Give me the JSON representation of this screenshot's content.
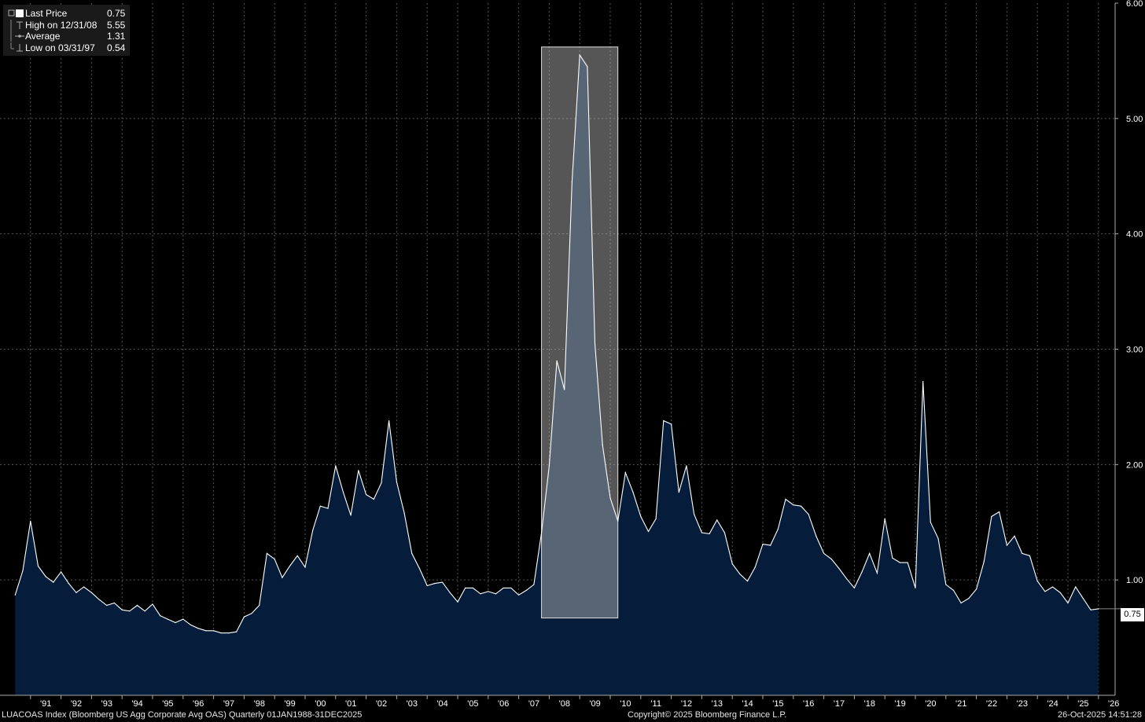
{
  "legend": {
    "items": [
      {
        "label": "Last Price",
        "value": "0.75"
      },
      {
        "label": "High on 12/31/08",
        "value": "5.55"
      },
      {
        "label": "Average",
        "value": "1.31"
      },
      {
        "label": "Low on 03/31/97",
        "value": "0.54"
      }
    ]
  },
  "footer": {
    "left": "LUACOAS Index (Bloomberg US Agg Corporate Avg OAS) Quarterly 01JAN1988-31DEC2025",
    "center": "Copyright© 2025 Bloomberg Finance L.P.",
    "right": "26-Oct-2025 14:51:28"
  },
  "last_price_badge": "0.75",
  "colors": {
    "background": "#000000",
    "area_fill": "#051d3a",
    "line": "#ffffff",
    "highlight": "#bfbfbf",
    "grid": "#555555"
  },
  "chart_data": {
    "type": "area",
    "title": "",
    "xlabel": "",
    "ylabel": "",
    "ylim": [
      0,
      6
    ],
    "yticks": [
      "1.00",
      "2.00",
      "3.00",
      "4.00",
      "5.00",
      "6.00"
    ],
    "xticks": [
      "'91",
      "'92",
      "'93",
      "'94",
      "'95",
      "'96",
      "'97",
      "'98",
      "'99",
      "'00",
      "'01",
      "'02",
      "'03",
      "'04",
      "'05",
      "'06",
      "'07",
      "'08",
      "'09",
      "'10",
      "'11",
      "'12",
      "'13",
      "'14",
      "'15",
      "'16",
      "'17",
      "'18",
      "'19",
      "'20",
      "'21",
      "'22",
      "'23",
      "'24",
      "'25",
      "'26"
    ],
    "grid": true,
    "legend_position": "top-left",
    "highlight_range": [
      "2007-09-30",
      "2010-03-31"
    ],
    "series": [
      {
        "values": [
          [
            "1990-06-30",
            0.87
          ],
          [
            "1990-09-30",
            1.08
          ],
          [
            "1990-12-31",
            1.51
          ],
          [
            "1991-03-31",
            1.12
          ],
          [
            "1991-06-30",
            1.03
          ],
          [
            "1991-09-30",
            0.98
          ],
          [
            "1991-12-31",
            1.07
          ],
          [
            "1992-03-31",
            0.97
          ],
          [
            "1992-06-30",
            0.89
          ],
          [
            "1992-09-30",
            0.94
          ],
          [
            "1992-12-31",
            0.89
          ],
          [
            "1993-03-31",
            0.83
          ],
          [
            "1993-06-30",
            0.78
          ],
          [
            "1993-09-30",
            0.8
          ],
          [
            "1993-12-31",
            0.74
          ],
          [
            "1994-03-31",
            0.73
          ],
          [
            "1994-06-30",
            0.78
          ],
          [
            "1994-09-30",
            0.73
          ],
          [
            "1994-12-31",
            0.79
          ],
          [
            "1995-03-31",
            0.69
          ],
          [
            "1995-06-30",
            0.66
          ],
          [
            "1995-09-30",
            0.63
          ],
          [
            "1995-12-31",
            0.66
          ],
          [
            "1996-03-31",
            0.61
          ],
          [
            "1996-06-30",
            0.58
          ],
          [
            "1996-09-30",
            0.56
          ],
          [
            "1996-12-31",
            0.56
          ],
          [
            "1997-03-31",
            0.54
          ],
          [
            "1997-06-30",
            0.54
          ],
          [
            "1997-09-30",
            0.55
          ],
          [
            "1997-12-31",
            0.68
          ],
          [
            "1998-03-31",
            0.71
          ],
          [
            "1998-06-30",
            0.78
          ],
          [
            "1998-09-30",
            1.23
          ],
          [
            "1998-12-31",
            1.18
          ],
          [
            "1999-03-31",
            1.02
          ],
          [
            "1999-06-30",
            1.12
          ],
          [
            "1999-09-30",
            1.21
          ],
          [
            "1999-12-31",
            1.11
          ],
          [
            "2000-03-31",
            1.43
          ],
          [
            "2000-06-30",
            1.64
          ],
          [
            "2000-09-30",
            1.62
          ],
          [
            "2000-12-31",
            1.99
          ],
          [
            "2001-03-31",
            1.76
          ],
          [
            "2001-06-30",
            1.56
          ],
          [
            "2001-09-30",
            1.95
          ],
          [
            "2001-12-31",
            1.74
          ],
          [
            "2002-03-31",
            1.7
          ],
          [
            "2002-06-30",
            1.84
          ],
          [
            "2002-09-30",
            2.38
          ],
          [
            "2002-12-31",
            1.85
          ],
          [
            "2003-03-31",
            1.58
          ],
          [
            "2003-06-30",
            1.23
          ],
          [
            "2003-09-30",
            1.1
          ],
          [
            "2003-12-31",
            0.95
          ],
          [
            "2004-03-31",
            0.97
          ],
          [
            "2004-06-30",
            0.98
          ],
          [
            "2004-09-30",
            0.89
          ],
          [
            "2004-12-31",
            0.81
          ],
          [
            "2005-03-31",
            0.93
          ],
          [
            "2005-06-30",
            0.93
          ],
          [
            "2005-09-30",
            0.88
          ],
          [
            "2005-12-31",
            0.9
          ],
          [
            "2006-03-31",
            0.88
          ],
          [
            "2006-06-30",
            0.93
          ],
          [
            "2006-09-30",
            0.93
          ],
          [
            "2006-12-31",
            0.87
          ],
          [
            "2007-03-31",
            0.91
          ],
          [
            "2007-06-30",
            0.96
          ],
          [
            "2007-09-30",
            1.41
          ],
          [
            "2007-12-31",
            1.99
          ],
          [
            "2008-03-31",
            2.9
          ],
          [
            "2008-06-30",
            2.65
          ],
          [
            "2008-09-30",
            4.45
          ],
          [
            "2008-12-31",
            5.55
          ],
          [
            "2009-03-31",
            5.45
          ],
          [
            "2009-06-30",
            3.05
          ],
          [
            "2009-09-30",
            2.17
          ],
          [
            "2009-12-31",
            1.71
          ],
          [
            "2010-03-31",
            1.51
          ],
          [
            "2010-06-30",
            1.93
          ],
          [
            "2010-09-30",
            1.76
          ],
          [
            "2010-12-31",
            1.55
          ],
          [
            "2011-03-31",
            1.42
          ],
          [
            "2011-06-30",
            1.53
          ],
          [
            "2011-09-30",
            2.38
          ],
          [
            "2011-12-31",
            2.35
          ],
          [
            "2012-03-31",
            1.76
          ],
          [
            "2012-06-30",
            1.99
          ],
          [
            "2012-09-30",
            1.57
          ],
          [
            "2012-12-31",
            1.41
          ],
          [
            "2013-03-31",
            1.4
          ],
          [
            "2013-06-30",
            1.52
          ],
          [
            "2013-09-30",
            1.41
          ],
          [
            "2013-12-31",
            1.14
          ],
          [
            "2014-03-31",
            1.05
          ],
          [
            "2014-06-30",
            0.99
          ],
          [
            "2014-09-30",
            1.11
          ],
          [
            "2014-12-31",
            1.31
          ],
          [
            "2015-03-31",
            1.3
          ],
          [
            "2015-06-30",
            1.44
          ],
          [
            "2015-09-30",
            1.7
          ],
          [
            "2015-12-31",
            1.65
          ],
          [
            "2016-03-31",
            1.64
          ],
          [
            "2016-06-30",
            1.57
          ],
          [
            "2016-09-30",
            1.38
          ],
          [
            "2016-12-31",
            1.23
          ],
          [
            "2017-03-31",
            1.18
          ],
          [
            "2017-06-30",
            1.1
          ],
          [
            "2017-09-30",
            1.01
          ],
          [
            "2017-12-31",
            0.93
          ],
          [
            "2018-03-31",
            1.07
          ],
          [
            "2018-06-30",
            1.23
          ],
          [
            "2018-09-30",
            1.06
          ],
          [
            "2018-12-31",
            1.53
          ],
          [
            "2019-03-31",
            1.19
          ],
          [
            "2019-06-30",
            1.15
          ],
          [
            "2019-09-30",
            1.15
          ],
          [
            "2019-12-31",
            0.93
          ],
          [
            "2020-03-31",
            2.72
          ],
          [
            "2020-06-30",
            1.5
          ],
          [
            "2020-09-30",
            1.36
          ],
          [
            "2020-12-31",
            0.96
          ],
          [
            "2021-03-31",
            0.91
          ],
          [
            "2021-06-30",
            0.8
          ],
          [
            "2021-09-30",
            0.84
          ],
          [
            "2021-12-31",
            0.92
          ],
          [
            "2022-03-31",
            1.16
          ],
          [
            "2022-06-30",
            1.55
          ],
          [
            "2022-09-30",
            1.59
          ],
          [
            "2022-12-31",
            1.3
          ],
          [
            "2023-03-31",
            1.38
          ],
          [
            "2023-06-30",
            1.23
          ],
          [
            "2023-09-30",
            1.21
          ],
          [
            "2023-12-31",
            0.99
          ],
          [
            "2024-03-31",
            0.9
          ],
          [
            "2024-06-30",
            0.94
          ],
          [
            "2024-09-30",
            0.89
          ],
          [
            "2024-12-31",
            0.8
          ],
          [
            "2025-03-31",
            0.94
          ],
          [
            "2025-06-30",
            0.84
          ],
          [
            "2025-09-30",
            0.74
          ],
          [
            "2025-12-31",
            0.75
          ]
        ]
      }
    ]
  }
}
